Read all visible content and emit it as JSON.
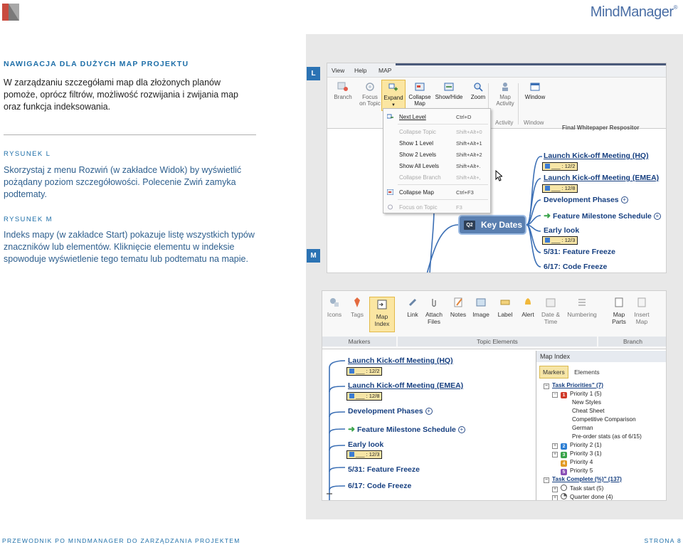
{
  "header": {
    "brand": "MindManager",
    "brand_mark": "®",
    "logo_icon": "mindjet-logo-icon",
    "brand_color": "#4a6ea5",
    "accent_color": "#1d6ea8"
  },
  "section": {
    "title": "NAWIGACJA DLA DUŻYCH MAP PROJEKTU",
    "intro": "W zarządzaniu szczegółami map dla złożonych planów pomoże, oprócz filtrów, możliwość rozwijania i zwijania map oraz funkcja indeksowania."
  },
  "figures": {
    "l": {
      "label": "RYSUNEK L",
      "text": "Skorzystaj z menu Rozwiń (w zakładce Widok) by wyświetlić pożądany poziom szczegółowości. Polecenie Zwiń zamyka podtematy.",
      "marker": "L"
    },
    "m": {
      "label": "RYSUNEK M",
      "text": "Indeks mapy (w zakładce Start) pokazuje listę wszystkich typów znaczników lub elementów. Kliknięcie elementu w indeksie spowoduje wyświetlenie tego tematu lub podtematu na mapie.",
      "marker": "M"
    }
  },
  "shot_l": {
    "tabs": [
      "View",
      "Help",
      "MAP"
    ],
    "ribbon": [
      {
        "label": "Branch",
        "icon": "branch-icon"
      },
      {
        "label": "Focus\non Topic",
        "icon": "focus-icon"
      },
      {
        "label": "Expand",
        "icon": "expand-icon"
      },
      {
        "label": "Collapse\nMap",
        "icon": "collapse-map-icon"
      },
      {
        "label": "Show/Hide",
        "icon": "show-hide-icon"
      },
      {
        "label": "Zoom",
        "icon": "zoom-icon"
      },
      {
        "label": "Map\nActivity",
        "icon": "map-activity-icon"
      },
      {
        "label": "Window",
        "icon": "window-icon"
      }
    ],
    "groups": [
      "Activity",
      "Window"
    ],
    "menu": [
      {
        "label": "Next Level",
        "shortcut": "Ctrl+D",
        "disabled": false,
        "underline": "N"
      },
      {
        "label": "Collapse Topic",
        "shortcut": "Shift+Alt+0",
        "disabled": true
      },
      {
        "label": "Show 1 Level",
        "shortcut": "Shift+Alt+1",
        "disabled": false
      },
      {
        "label": "Show 2 Levels",
        "shortcut": "Shift+Alt+2",
        "disabled": false
      },
      {
        "label": "Show All Levels",
        "shortcut": "Shift+Alt+.",
        "disabled": false
      },
      {
        "label": "Collapse Branch",
        "shortcut": "Shift+Alt+,",
        "disabled": true
      },
      {
        "label": "Collapse Map",
        "shortcut": "Ctrl+F3",
        "disabled": false
      },
      {
        "label": "Focus on Topic",
        "shortcut": "F3",
        "disabled": true
      }
    ],
    "doc_title": "Final Whitepaper Respositor",
    "central_topic": "Key Dates",
    "central_badge": "Q2",
    "topics": [
      {
        "label": "Launch Kick-off Meeting (HQ)",
        "tag": "___ : 12/2"
      },
      {
        "label": "Launch Kick-off Meeting (EMEA)",
        "tag": "___ : 12/8"
      },
      {
        "label": "Development Phases"
      },
      {
        "label": "Feature Milestone Schedule"
      },
      {
        "label": "Early look",
        "tag": "___ : 12/3"
      },
      {
        "label": "5/31: Feature Freeze"
      },
      {
        "label": "6/17: Code Freeze"
      }
    ]
  },
  "shot_m": {
    "ribbon": [
      {
        "label": "Icons",
        "icon": "icons-icon"
      },
      {
        "label": "Tags",
        "icon": "tags-icon"
      },
      {
        "label": "Map\nIndex",
        "icon": "map-index-icon"
      },
      {
        "label": "Link",
        "icon": "link-icon"
      },
      {
        "label": "Attach\nFiles",
        "icon": "attach-icon"
      },
      {
        "label": "Notes",
        "icon": "notes-icon"
      },
      {
        "label": "Image",
        "icon": "image-icon"
      },
      {
        "label": "Label",
        "icon": "label-icon"
      },
      {
        "label": "Alert",
        "icon": "alert-icon"
      },
      {
        "label": "Date &\nTime",
        "icon": "date-icon"
      },
      {
        "label": "Numbering",
        "icon": "numbering-icon"
      },
      {
        "label": "Map\nParts",
        "icon": "map-parts-icon"
      },
      {
        "label": "Insert\nMap",
        "icon": "insert-map-icon"
      }
    ],
    "groups": [
      "Markers",
      "Topic Elements",
      "Branch"
    ],
    "index_title": "Map Index",
    "index_tabs": [
      "Markers",
      "Elements"
    ],
    "tree": [
      {
        "label": "Task Priorities\" (7)",
        "kind": "group"
      },
      {
        "label": "Priority 1 (5)",
        "kind": "priority",
        "n": "1",
        "color": "#d03a2a"
      },
      {
        "label": "New Styles",
        "kind": "leaf"
      },
      {
        "label": "Cheat Sheet",
        "kind": "leaf"
      },
      {
        "label": "Competitive Comparison",
        "kind": "leaf"
      },
      {
        "label": "German",
        "kind": "leaf"
      },
      {
        "label": "Pre-order stats (as of 6/15)",
        "kind": "leaf"
      },
      {
        "label": "Priority 2 (1)",
        "kind": "priority",
        "n": "2",
        "color": "#2d7fd4"
      },
      {
        "label": "Priority 3 (1)",
        "kind": "priority",
        "n": "3",
        "color": "#3aa34a"
      },
      {
        "label": "Priority 4",
        "kind": "priority",
        "n": "4",
        "color": "#e19a24"
      },
      {
        "label": "Priority 5",
        "kind": "priority",
        "n": "5",
        "color": "#8a4fb6"
      },
      {
        "label": "Task Complete (%)\" (137)",
        "kind": "group"
      },
      {
        "label": "Task start (5)",
        "kind": "clock"
      },
      {
        "label": "Quarter done (4)",
        "kind": "clock"
      }
    ],
    "topics": [
      {
        "label": "Launch Kick-off Meeting (HQ)",
        "tag": "___ : 12/2"
      },
      {
        "label": "Launch Kick-off Meeting (EMEA)",
        "tag": "___ : 12/8"
      },
      {
        "label": "Development Phases"
      },
      {
        "label": "Feature Milestone Schedule"
      },
      {
        "label": "Early look",
        "tag": "___ : 12/3"
      },
      {
        "label": "5/31: Feature Freeze"
      },
      {
        "label": "6/17: Code Freeze"
      }
    ]
  },
  "footer": {
    "left": "PRZEWODNIK PO MINDMANAGER DO ZARZĄDZANIA PROJEKTEM",
    "right": "STRONA 8"
  }
}
